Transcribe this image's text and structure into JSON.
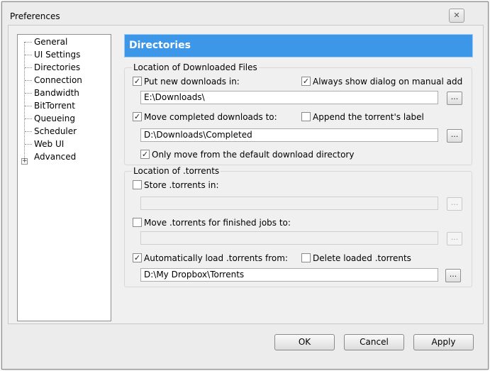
{
  "window": {
    "title": "Preferences",
    "close_glyph": "✕"
  },
  "sidebar": {
    "items": [
      {
        "label": "General"
      },
      {
        "label": "UI Settings"
      },
      {
        "label": "Directories",
        "selected": true
      },
      {
        "label": "Connection"
      },
      {
        "label": "Bandwidth"
      },
      {
        "label": "BitTorrent"
      },
      {
        "label": "Queueing"
      },
      {
        "label": "Scheduler"
      },
      {
        "label": "Web UI"
      },
      {
        "label": "Advanced",
        "expandable": true
      }
    ],
    "expander_glyph": "+"
  },
  "header": {
    "title": "Directories"
  },
  "downloaded_group": {
    "title": "Location of Downloaded Files",
    "put_new": {
      "label": "Put new downloads in:",
      "checked": true
    },
    "always_show_dialog": {
      "label": "Always show dialog on manual add",
      "checked": true
    },
    "put_new_path": "E:\\Downloads\\",
    "move_completed": {
      "label": "Move completed downloads to:",
      "checked": true
    },
    "append_label": {
      "label": "Append the torrent's label",
      "checked": false
    },
    "move_completed_path": "D:\\Downloads\\Completed",
    "only_move_default": {
      "label": "Only move from the default download directory",
      "checked": true
    }
  },
  "torrents_group": {
    "title": "Location of .torrents",
    "store": {
      "label": "Store .torrents in:",
      "checked": false
    },
    "store_path": "",
    "move_finished": {
      "label": "Move .torrents for finished jobs to:",
      "checked": false
    },
    "move_finished_path": "",
    "auto_load": {
      "label": "Automatically load .torrents from:",
      "checked": true
    },
    "delete_loaded": {
      "label": "Delete loaded .torrents",
      "checked": false
    },
    "auto_load_path": "D:\\My Dropbox\\Torrents"
  },
  "browse_label": "...",
  "check_glyph": "✓",
  "buttons": {
    "ok": "OK",
    "cancel": "Cancel",
    "apply": "Apply"
  },
  "colors": {
    "header_bg": "#3d97e8",
    "selection": "#3d97e8"
  }
}
